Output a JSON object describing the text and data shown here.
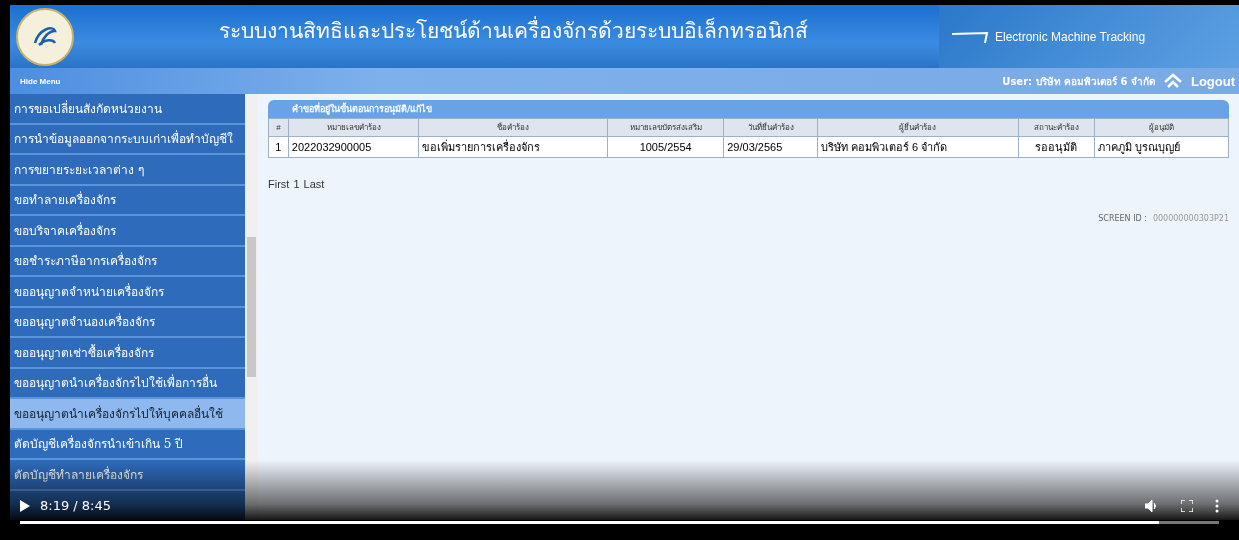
{
  "header": {
    "title": "ระบบงานสิทธิและประโยชน์ด้านเครื่องจักรด้วยระบบอิเล็กทรอนิกส์",
    "brand": "Electronic Machine Tracking"
  },
  "menu_bar": {
    "hide_menu": "Hide Menu",
    "user": "User: บริษัท คอมพิวเตอร์ 6 จำกัด",
    "logout": "Logout"
  },
  "sidebar": {
    "items": [
      {
        "label": "การขอเปลี่ยนสังกัดหน่วยงาน",
        "selected": false
      },
      {
        "label": "การนำข้อมูลออกจากระบบเก่าเพื่อทำบัญชีใ",
        "selected": false
      },
      {
        "label": "การขยายระยะเวลาต่าง ๆ",
        "selected": false
      },
      {
        "label": "ขอทำลายเครื่องจักร",
        "selected": false
      },
      {
        "label": "ขอบริจาคเครื่องจักร",
        "selected": false
      },
      {
        "label": "ขอชำระภาษีอากรเครื่องจักร",
        "selected": false
      },
      {
        "label": "ขออนุญาตจำหน่ายเครื่องจักร",
        "selected": false
      },
      {
        "label": "ขออนุญาตจำนองเครื่องจักร",
        "selected": false
      },
      {
        "label": "ขออนุญาตเช่าซื้อเครื่องจักร",
        "selected": false
      },
      {
        "label": "ขออนุญาตนำเครื่องจักรไปใช้เพื่อการอื่น",
        "selected": false
      },
      {
        "label": "ขออนุญาตนำเครื่องจักรไปให้บุคคลอื่นใช้",
        "selected": true
      },
      {
        "label": "ตัดบัญชีเครื่องจักรนำเข้าเกิน 5 ปี",
        "selected": false
      },
      {
        "label": "ตัดบัญชีทำลายเครื่องจักร",
        "selected": false
      }
    ]
  },
  "panel": {
    "title": "คำขอที่อยู่ในขั้นตอนการอนุมัติ/แก้ไข",
    "table": {
      "columns": [
        "#",
        "หมายเลขคำร้อง",
        "ชื่อคำร้อง",
        "หมายเลขบัตรส่งเสริม",
        "วันที่ยื่นคำร้อง",
        "ผู้ยื่นคำร้อง",
        "สถานะคำร้อง",
        "ผู้อนุมัติ"
      ],
      "rows": [
        [
          "1",
          "2022032900005",
          "ขอเพิ่มรายการเครื่องจักร",
          "1005/2554",
          "29/03/2565",
          "บริษัท คอมพิวเตอร์ 6 จำกัด",
          "รออนุมัติ",
          "ภาคภูมิ บูรณบุญย์"
        ]
      ]
    },
    "pager": [
      "First",
      "1",
      "Last"
    ],
    "screen_id": {
      "label": "SCREEN ID :",
      "value": "000000000303P21"
    }
  },
  "video": {
    "time": "8:19 / 8:45",
    "level": 0.95
  }
}
